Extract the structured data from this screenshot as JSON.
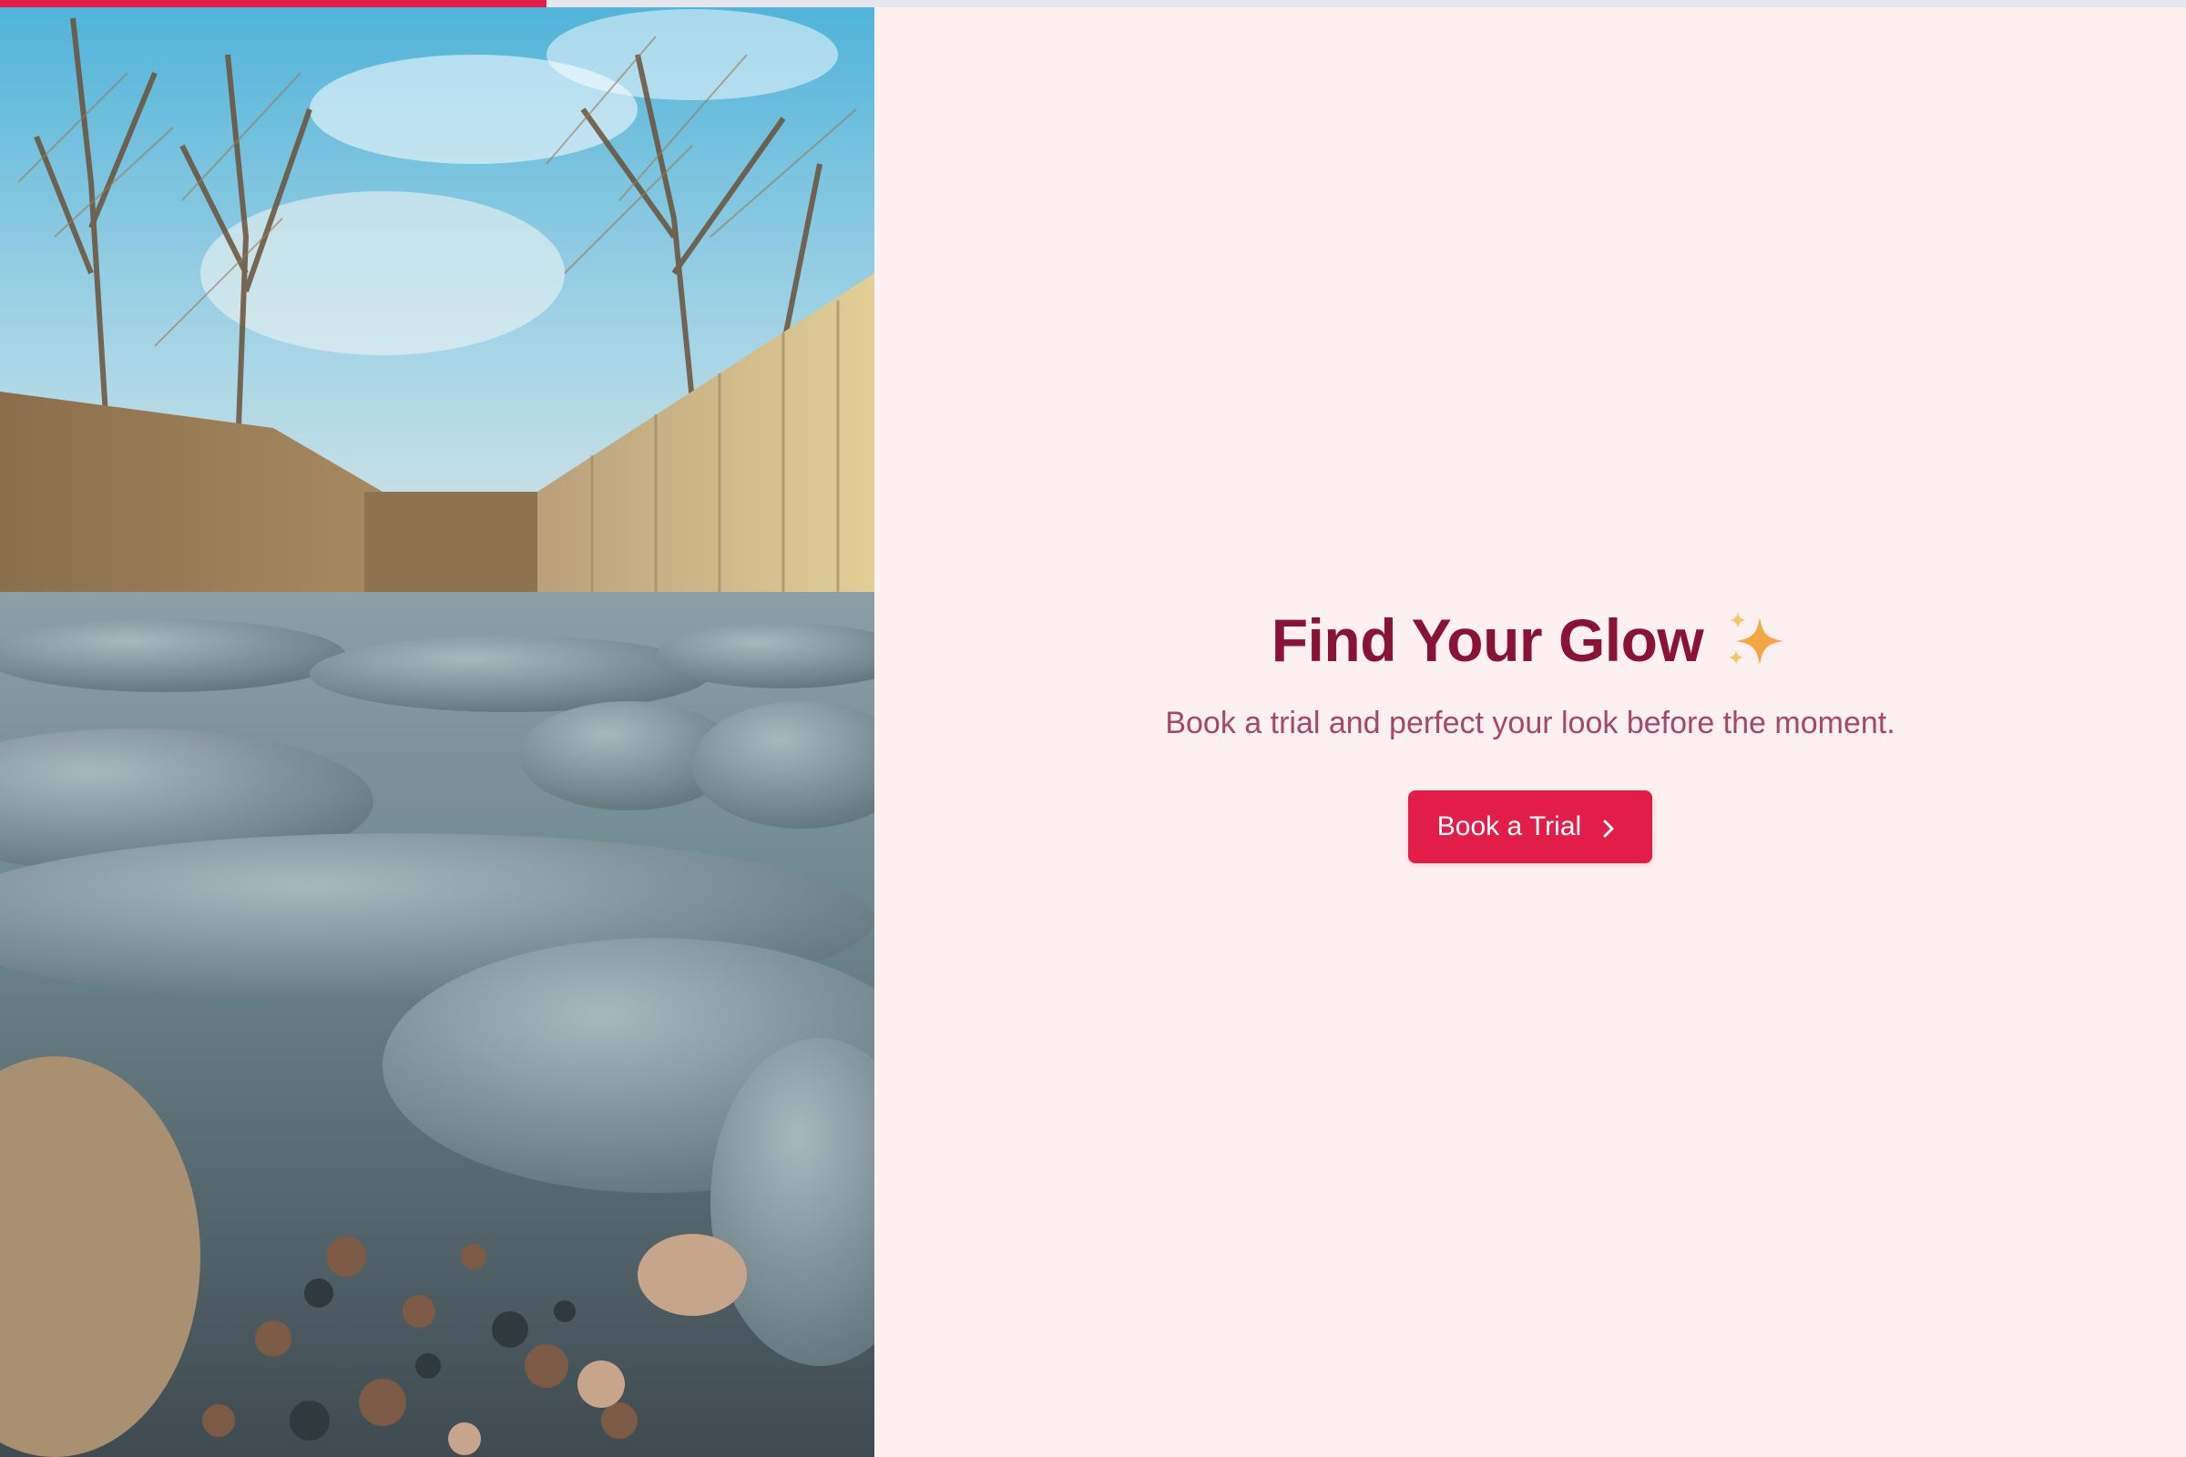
{
  "progress": {
    "value": 0.25
  },
  "hero": {
    "title": "Find Your Glow",
    "title_icon": "sparkles-icon",
    "subtitle": "Book a trial and perfect your look before the moment.",
    "cta_label": "Book a Trial",
    "cta_icon": "chevron-right-icon"
  },
  "photo": {
    "subject": "cobblestone-street-image"
  },
  "colors": {
    "accent": "#e11d48",
    "title": "#881337",
    "subtitle": "#a3476b",
    "background": "#fdf0f0",
    "progress_track": "#e6e7ec"
  }
}
